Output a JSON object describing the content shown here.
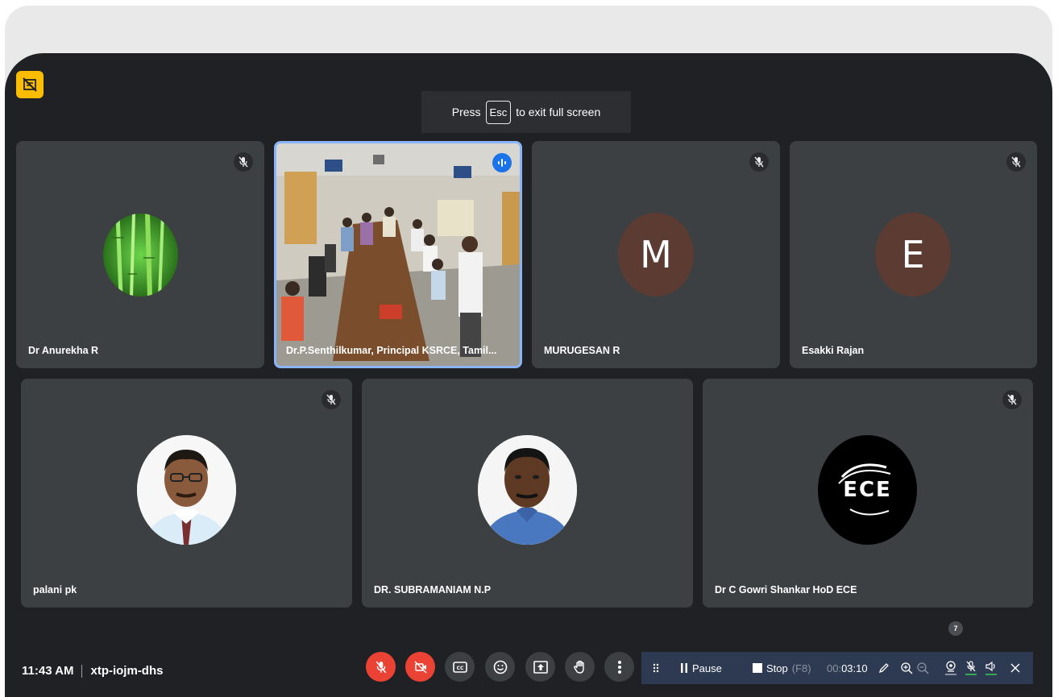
{
  "banner": {
    "press": "Press",
    "key": "Esc",
    "rest": "to exit full screen"
  },
  "participants": [
    {
      "name": "Dr Anurekha R",
      "avatar": "bamboo-photo",
      "muted": true
    },
    {
      "name": "Dr.P.Senthilkumar, Principal KSRCE, Tamil...",
      "avatar": "meeting-room-video",
      "speaking": true
    },
    {
      "name": "MURUGESAN R",
      "avatar_letter": "M",
      "avatar_color": "#5c3b32",
      "muted": true
    },
    {
      "name": "Esakki Rajan",
      "avatar_letter": "E",
      "avatar_color": "#5c3b32",
      "muted": true
    },
    {
      "name": "palani pk",
      "avatar": "portrait-photo",
      "muted": true
    },
    {
      "name": "DR. SUBRAMANIAM N.P",
      "avatar": "portrait-photo"
    },
    {
      "name": "Dr C Gowri Shankar HoD ECE",
      "avatar": "ece-logo",
      "logo_text": "ECE",
      "muted": true
    }
  ],
  "footer": {
    "time": "11:43 AM",
    "meeting_code": "xtp-iojm-dhs"
  },
  "recorder": {
    "pause_label": "Pause",
    "stop_label": "Stop",
    "stop_key": "(F8)",
    "elapsed_dim": "00:",
    "elapsed": "03:10",
    "badge_count": "7"
  },
  "colors": {
    "background": "#202124",
    "tile": "#3c4043",
    "red": "#ea4335",
    "highlight": "#8ab4f8",
    "accent_yellow": "#fbbc04"
  }
}
